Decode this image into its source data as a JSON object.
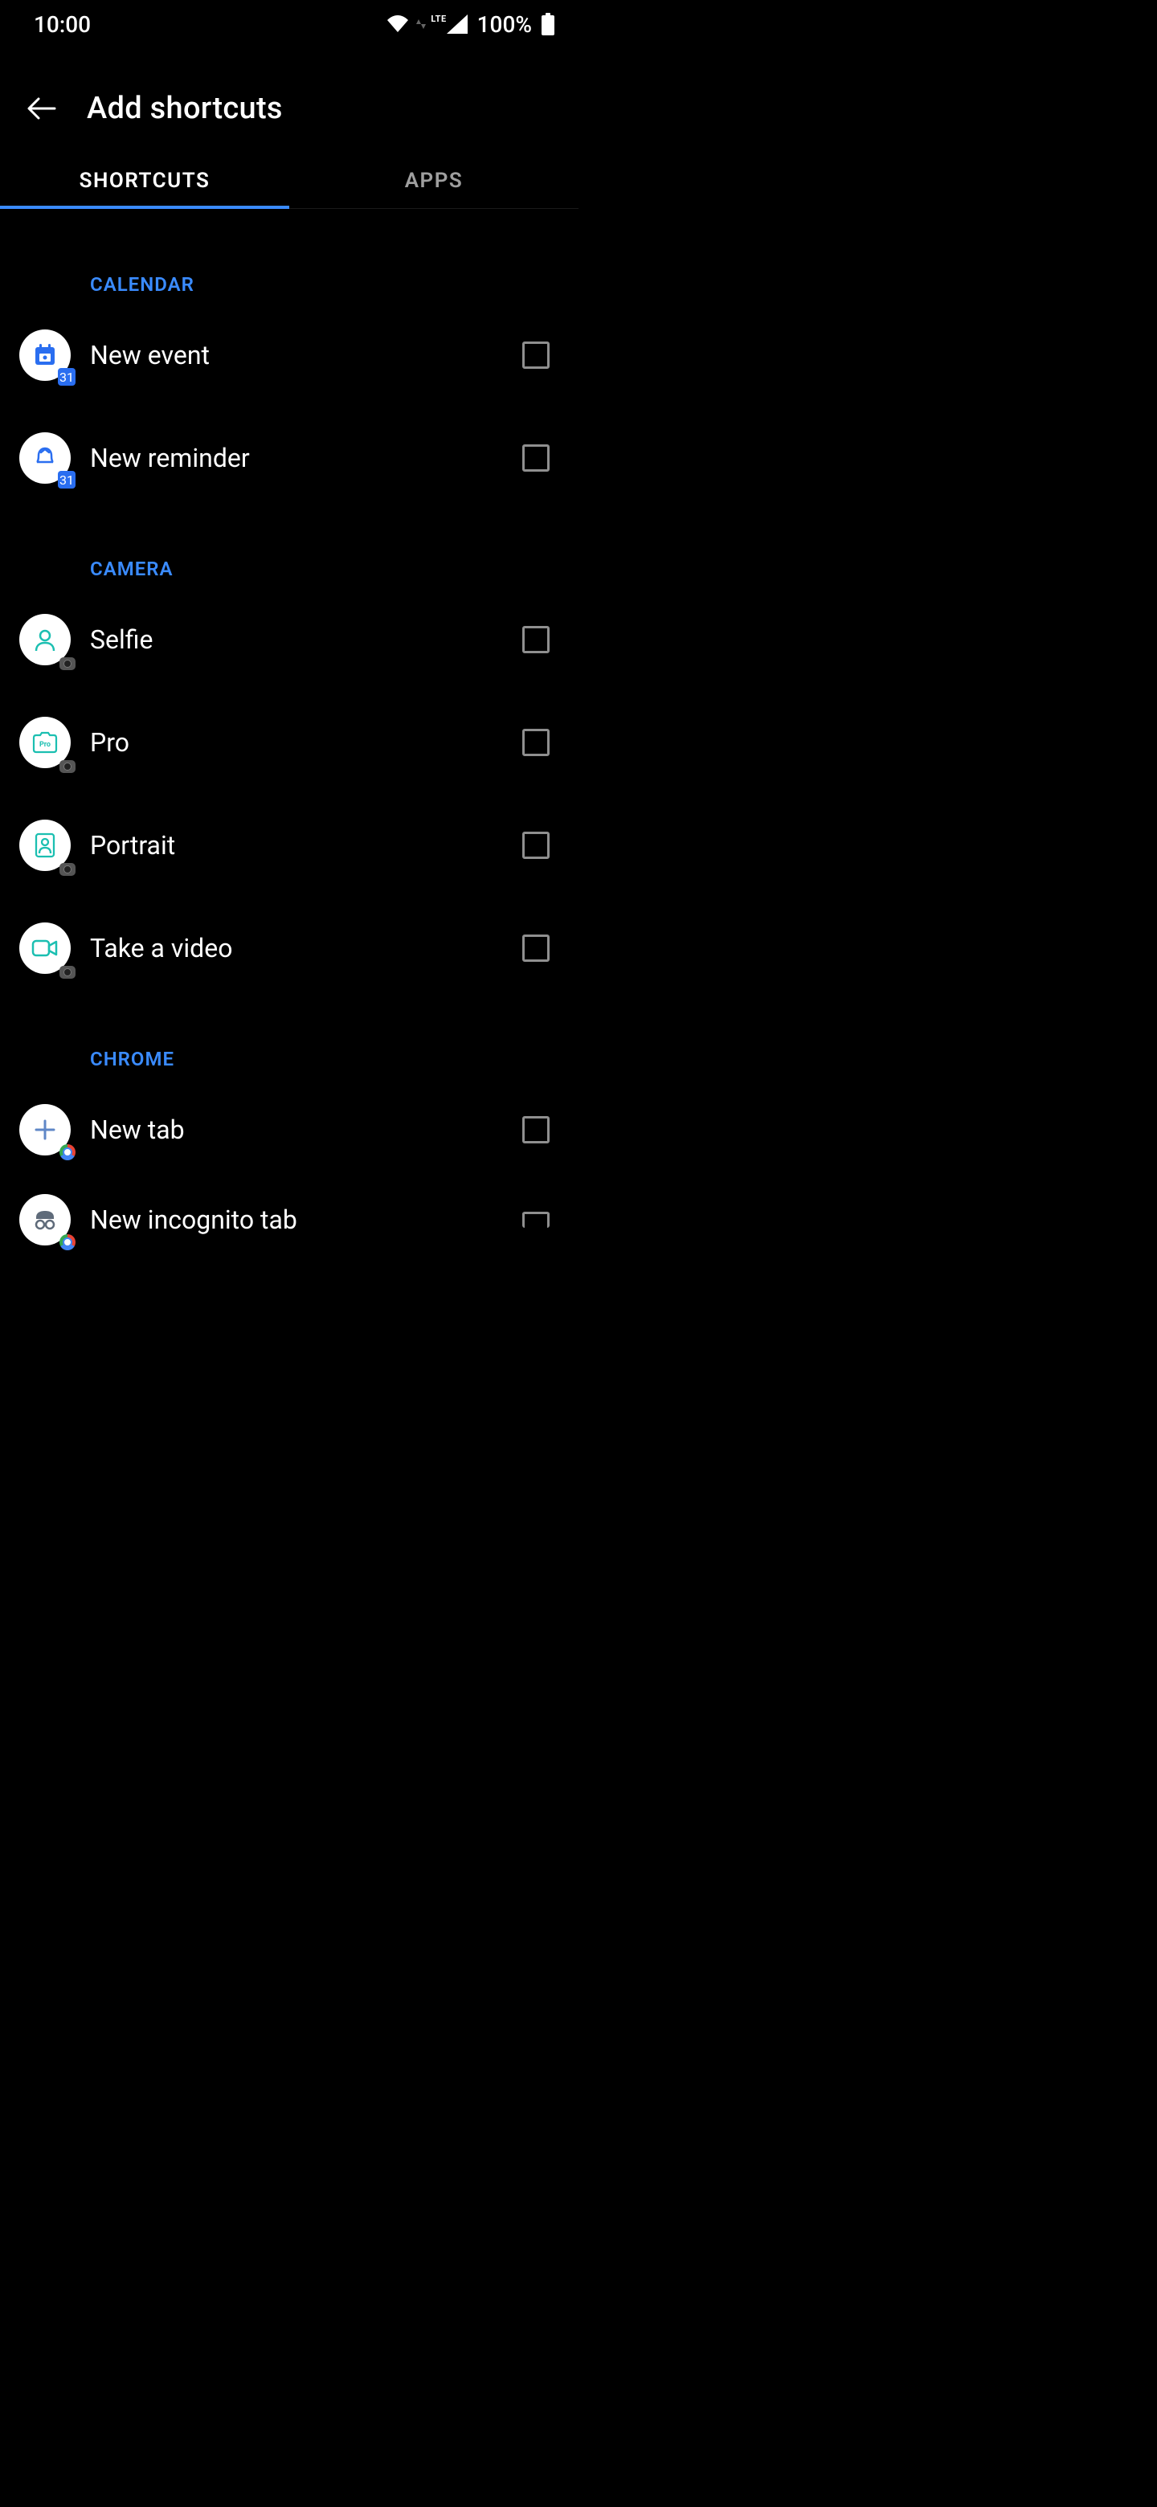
{
  "status": {
    "time": "10:00",
    "battery": "100%",
    "lte": "LTE"
  },
  "header": {
    "title": "Add shortcuts"
  },
  "tabs": {
    "shortcuts": "SHORTCUTS",
    "apps": "APPS"
  },
  "sections": {
    "calendar": {
      "title": "CALENDAR",
      "items": [
        {
          "label": "New event"
        },
        {
          "label": "New reminder"
        }
      ]
    },
    "camera": {
      "title": "CAMERA",
      "items": [
        {
          "label": "Selfie"
        },
        {
          "label": "Pro"
        },
        {
          "label": "Portrait"
        },
        {
          "label": "Take a video"
        }
      ]
    },
    "chrome": {
      "title": "CHROME",
      "items": [
        {
          "label": "New tab"
        },
        {
          "label": "New incognito tab"
        }
      ]
    }
  }
}
